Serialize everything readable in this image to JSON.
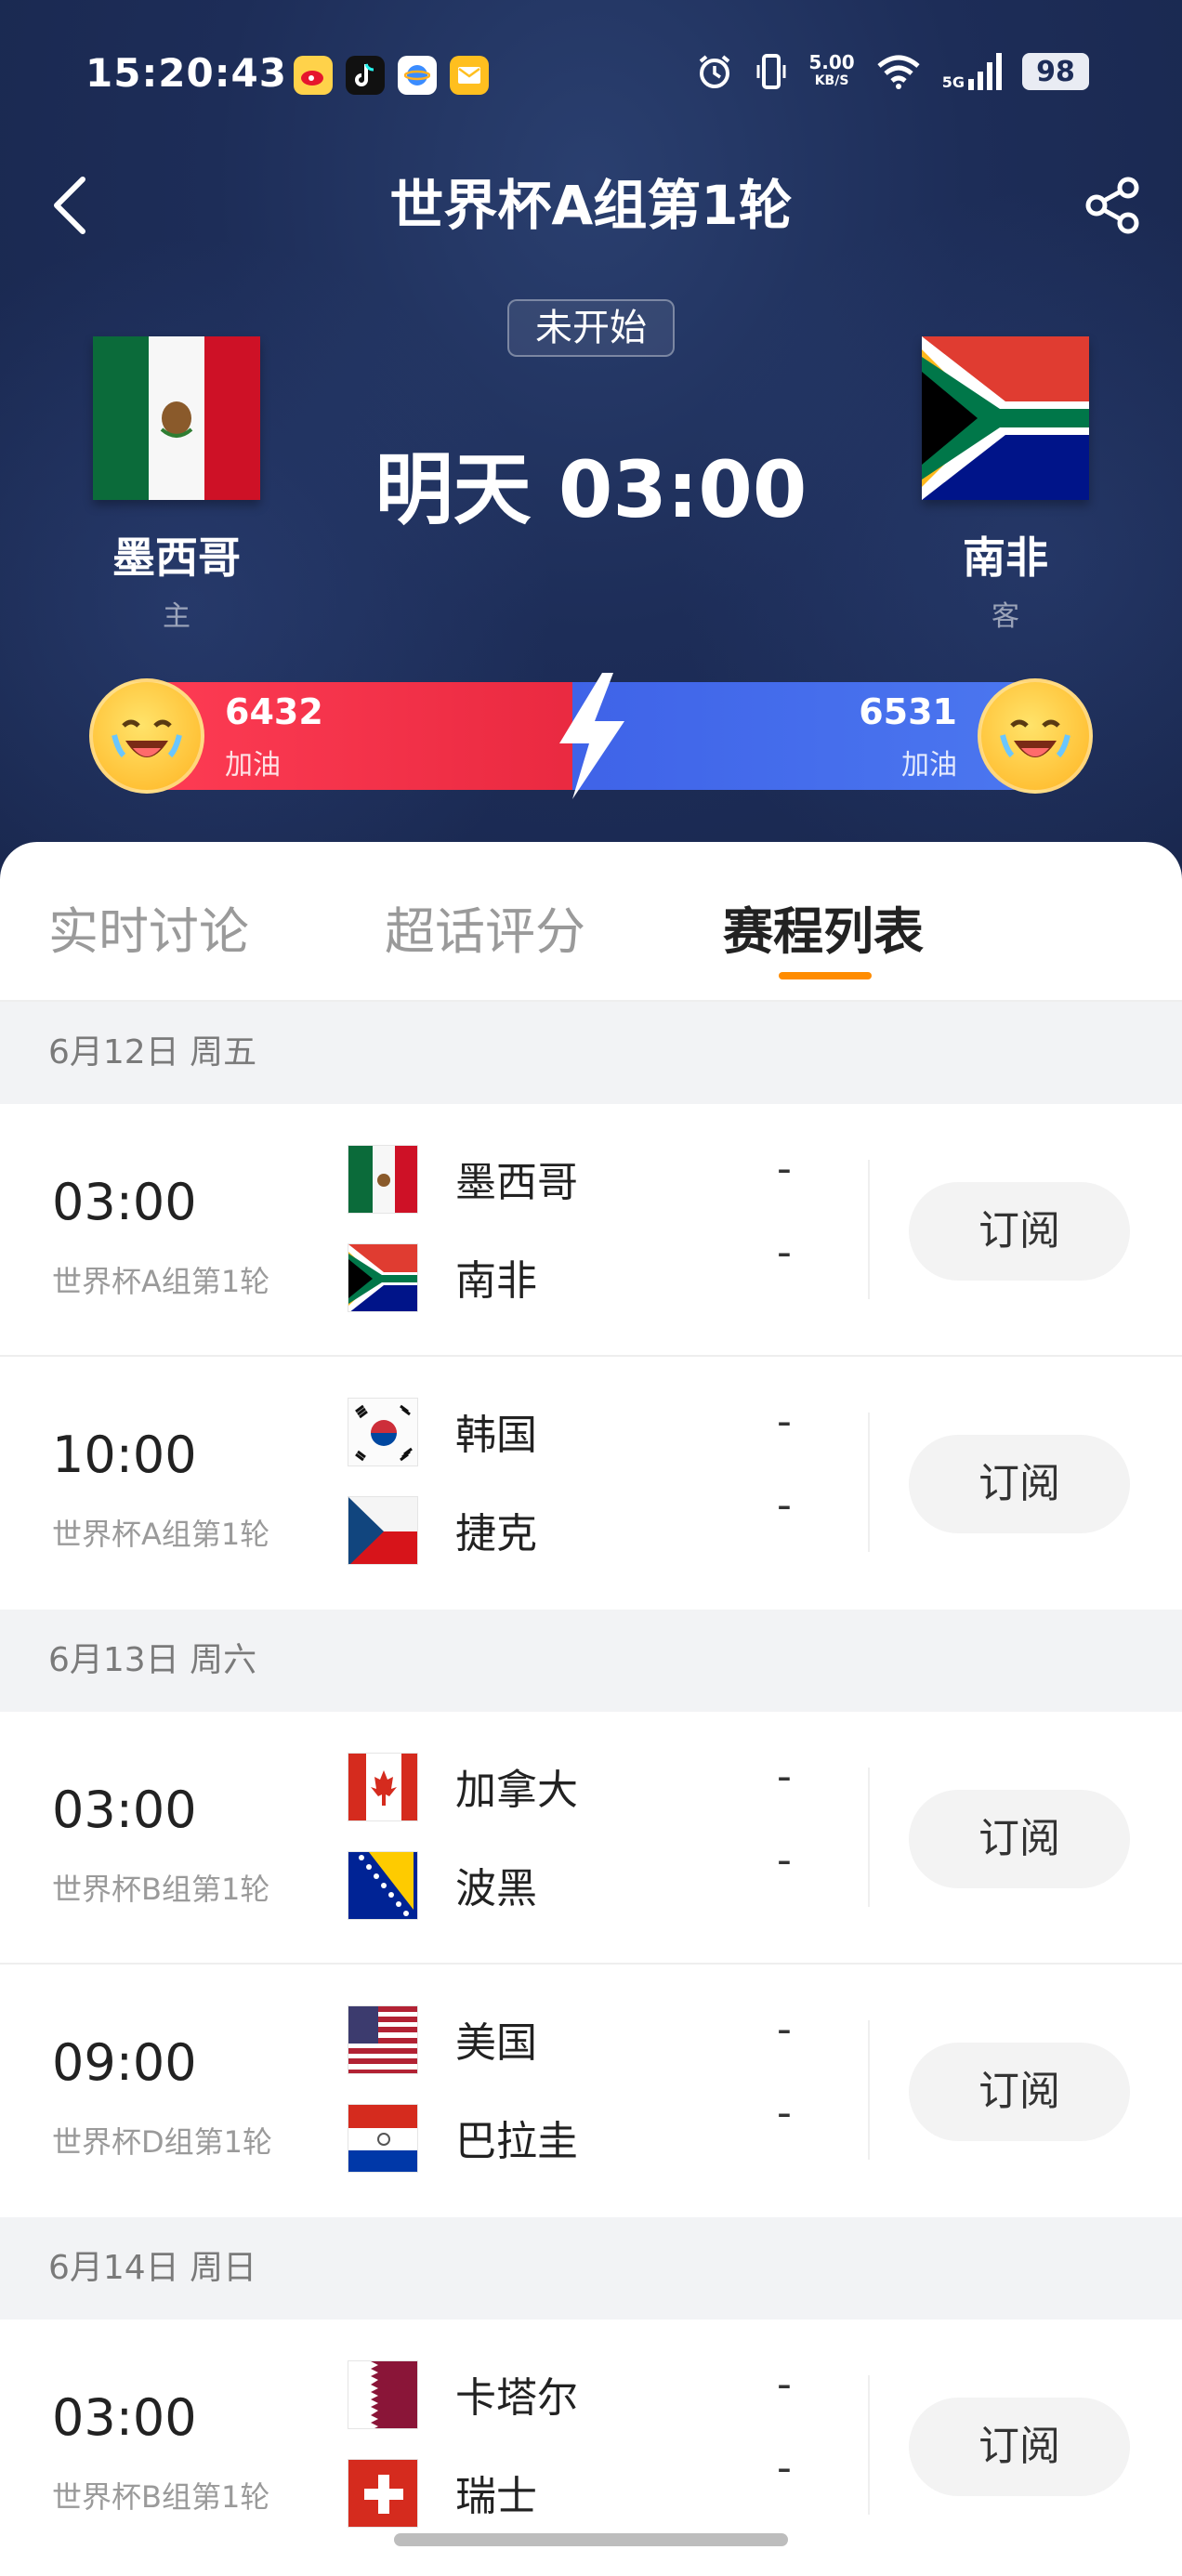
{
  "status_bar": {
    "time": "15:20:43",
    "speed_value": "5.00",
    "speed_unit": "KB/S",
    "network": "5G",
    "battery": "98",
    "app_icons": [
      "weibo-icon",
      "tiktok-icon",
      "browser-icon",
      "mail-icon"
    ]
  },
  "nav": {
    "title": "世界杯A组第1轮"
  },
  "match": {
    "status": "未开始",
    "kickoff": "明天 03:00",
    "home": {
      "name": "墨西哥",
      "role": "主"
    },
    "away": {
      "name": "南非",
      "role": "客"
    }
  },
  "cheer": {
    "home_count": "6432",
    "home_label": "加油",
    "away_count": "6531",
    "away_label": "加油",
    "home_color": "#e8283f",
    "away_color": "#4c78f0"
  },
  "tabs": [
    {
      "label": "实时讨论"
    },
    {
      "label": "超话评分"
    },
    {
      "label": "赛程列表"
    }
  ],
  "active_tab_color": "#ff8c00",
  "schedule": [
    {
      "date": "6月12日 周五",
      "matches": [
        {
          "time": "03:00",
          "round": "世界杯A组第1轮",
          "team1": "墨西哥",
          "team2": "南非",
          "score1": "-",
          "score2": "-",
          "button": "订阅"
        },
        {
          "time": "10:00",
          "round": "世界杯A组第1轮",
          "team1": "韩国",
          "team2": "捷克",
          "score1": "-",
          "score2": "-",
          "button": "订阅"
        }
      ]
    },
    {
      "date": "6月13日 周六",
      "matches": [
        {
          "time": "03:00",
          "round": "世界杯B组第1轮",
          "team1": "加拿大",
          "team2": "波黑",
          "score1": "-",
          "score2": "-",
          "button": "订阅"
        },
        {
          "time": "09:00",
          "round": "世界杯D组第1轮",
          "team1": "美国",
          "team2": "巴拉圭",
          "score1": "-",
          "score2": "-",
          "button": "订阅"
        }
      ]
    },
    {
      "date": "6月14日 周日",
      "matches": [
        {
          "time": "03:00",
          "round": "世界杯B组第1轮",
          "team1": "卡塔尔",
          "team2": "瑞士",
          "score1": "-",
          "score2": "-",
          "button": "订阅"
        }
      ]
    }
  ]
}
